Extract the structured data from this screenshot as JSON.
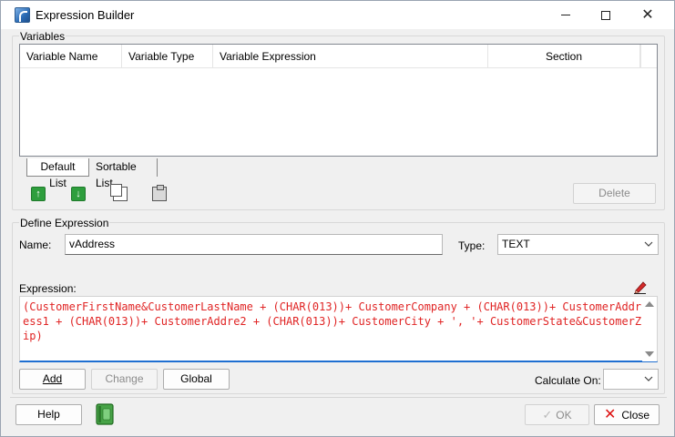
{
  "window": {
    "title": "Expression Builder",
    "icon": "app-icon",
    "controls": {
      "minimize": "minimize-icon",
      "maximize": "maximize-icon",
      "close": "close-icon"
    }
  },
  "variables": {
    "group_label": "Variables",
    "columns": [
      "Variable Name",
      "Variable Type",
      "Variable Expression",
      "Section"
    ],
    "rows": [],
    "tabs": [
      {
        "label": "Default List",
        "active": true
      },
      {
        "label": "Sortable List",
        "active": false
      }
    ],
    "toolbar": {
      "move_up_icon": "arrow-up-icon",
      "move_down_icon": "arrow-down-icon",
      "copy_icon": "copy-icon",
      "paste_icon": "paste-icon",
      "delete_label": "Delete"
    }
  },
  "define": {
    "group_label": "Define Expression",
    "name_label": "Name:",
    "name_value": "vAddress",
    "type_label": "Type:",
    "type_value": "TEXT",
    "expression_label": "Expression:",
    "expression_value": "(CustomerFirstName&CustomerLastName + (CHAR(013))+ CustomerCompany + (CHAR(013))+ CustomerAddress1 + (CHAR(013))+ CustomerAddre2 + (CHAR(013))+ CustomerCity + ', '+ CustomerState&CustomerZip)",
    "add_label": "Add",
    "change_label": "Change",
    "global_label": "Global",
    "calculate_on_label": "Calculate On:",
    "calculate_on_value": ""
  },
  "footer": {
    "help_label": "Help",
    "ok_label": "OK",
    "close_label": "Close"
  },
  "colors": {
    "expression_text": "#e02424",
    "accent": "#1f6fd1"
  }
}
